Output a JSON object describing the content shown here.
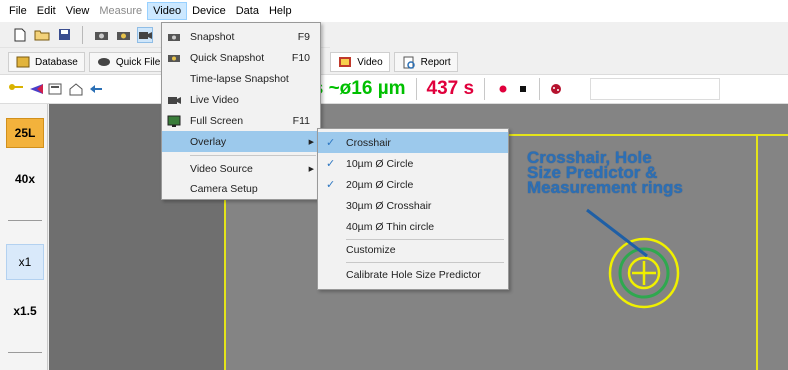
{
  "menubar": {
    "items": [
      "File",
      "Edit",
      "View",
      "Measure",
      "Video",
      "Device",
      "Data",
      "Help"
    ],
    "disabled": [
      "Measure"
    ],
    "active": "Video"
  },
  "toolbar2": {
    "tabs": [
      {
        "label": "Database",
        "icon": "database-icon"
      },
      {
        "label": "Quick File",
        "icon": "quick-file-icon"
      },
      {
        "label": "Video",
        "icon": "video-icon"
      },
      {
        "label": "Report",
        "icon": "report-icon"
      }
    ]
  },
  "toolbar3": {
    "measure_readout": "0 ms  ~ø16 µm",
    "time_readout": "437 s"
  },
  "left_panel": {
    "objective": "25L",
    "magnification": "40x",
    "zoom_1": "x1",
    "zoom_2": "x1.5"
  },
  "video_menu": {
    "items": [
      {
        "label": "Snapshot",
        "shortcut": "F9",
        "icon": "camera-icon"
      },
      {
        "label": "Quick Snapshot",
        "shortcut": "F10",
        "icon": "camera-icon"
      },
      {
        "label": "Time-lapse Snapshot",
        "shortcut": ""
      },
      {
        "label": "Live Video",
        "shortcut": "",
        "icon": "video-camera-icon"
      },
      {
        "label": "Full Screen",
        "shortcut": "F11",
        "icon": "monitor-icon"
      },
      {
        "label": "Overlay",
        "shortcut": "",
        "submenu": true
      },
      {
        "label": "Video Source",
        "shortcut": "",
        "submenu": true
      },
      {
        "label": "Camera Setup",
        "shortcut": ""
      }
    ]
  },
  "overlay_menu": {
    "items": [
      {
        "label": "Crosshair",
        "checked": true
      },
      {
        "label": "10µm Ø Circle",
        "checked": true
      },
      {
        "label": "20µm Ø Circle",
        "checked": true
      },
      {
        "label": "30µm Ø Crosshair",
        "checked": false
      },
      {
        "label": "40µm Ø Thin circle",
        "checked": false
      },
      {
        "label": "Customize",
        "checked": false
      },
      {
        "label": "Calibrate Hole Size Predictor",
        "checked": false
      }
    ]
  },
  "annotation": {
    "lines": [
      "Crosshair, Hole",
      "Size Predictor &",
      "Measurement rings"
    ]
  },
  "colors": {
    "readout_green": "#00c000",
    "readout_red": "#e0003c",
    "annotation_blue": "#2c6fb5",
    "overlay_yellow": "#f0f000",
    "overlay_green": "#2fa84f",
    "menu_highlight": "#9cc9ec"
  }
}
